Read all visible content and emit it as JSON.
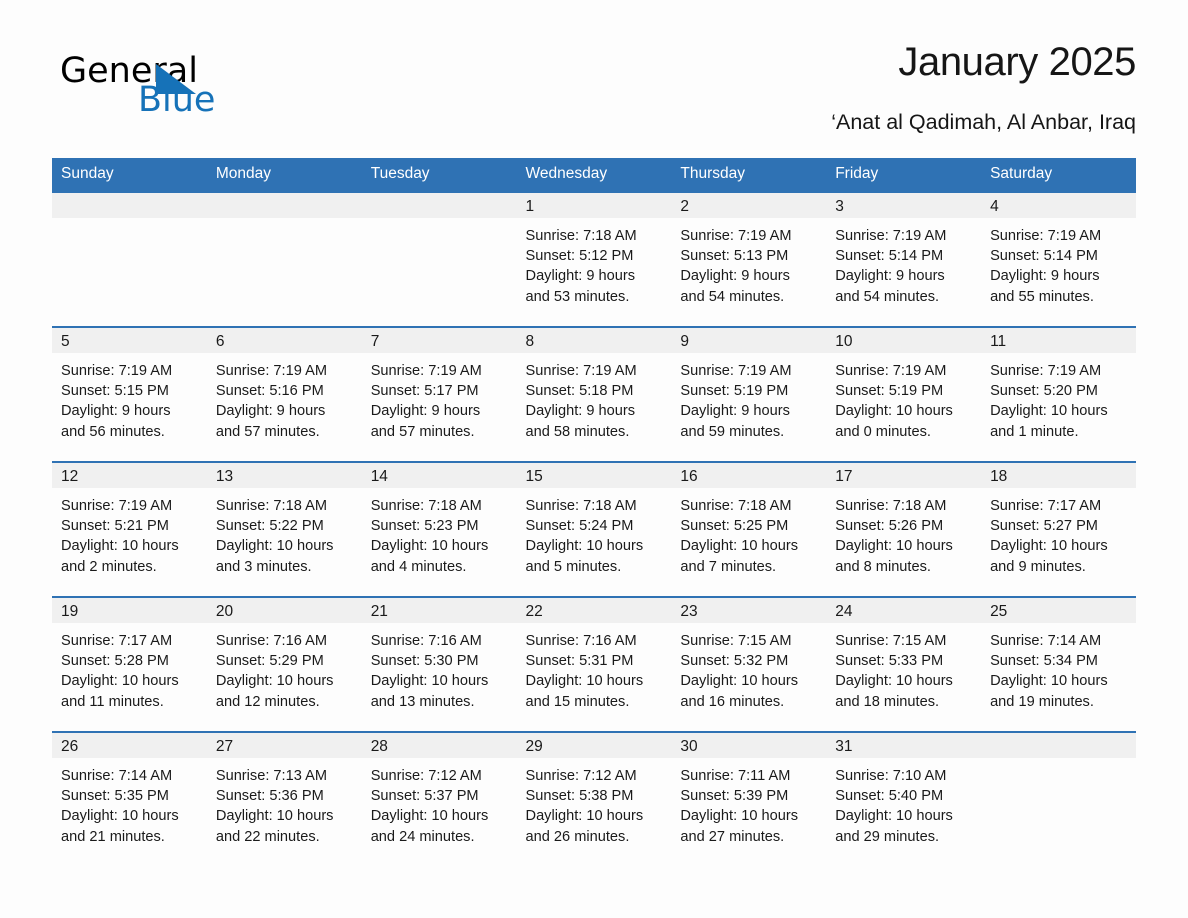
{
  "brand": {
    "logo_text_1": "General",
    "logo_text_2": "Blue",
    "logo_icon": "triangle-logo-icon",
    "accent_color": "#1672b8",
    "header_color": "#2f72b4"
  },
  "header": {
    "title": "January 2025",
    "subtitle": "‘Anat al Qadimah, Al Anbar, Iraq"
  },
  "calendar": {
    "weekday_headers": [
      "Sunday",
      "Monday",
      "Tuesday",
      "Wednesday",
      "Thursday",
      "Friday",
      "Saturday"
    ],
    "weeks": [
      [
        {
          "day": "",
          "empty": true
        },
        {
          "day": "",
          "empty": true
        },
        {
          "day": "",
          "empty": true
        },
        {
          "day": "1",
          "sunrise": "Sunrise: 7:18 AM",
          "sunset": "Sunset: 5:12 PM",
          "daylight_line1": "Daylight: 9 hours",
          "daylight_line2": "and 53 minutes."
        },
        {
          "day": "2",
          "sunrise": "Sunrise: 7:19 AM",
          "sunset": "Sunset: 5:13 PM",
          "daylight_line1": "Daylight: 9 hours",
          "daylight_line2": "and 54 minutes."
        },
        {
          "day": "3",
          "sunrise": "Sunrise: 7:19 AM",
          "sunset": "Sunset: 5:14 PM",
          "daylight_line1": "Daylight: 9 hours",
          "daylight_line2": "and 54 minutes."
        },
        {
          "day": "4",
          "sunrise": "Sunrise: 7:19 AM",
          "sunset": "Sunset: 5:14 PM",
          "daylight_line1": "Daylight: 9 hours",
          "daylight_line2": "and 55 minutes."
        }
      ],
      [
        {
          "day": "5",
          "sunrise": "Sunrise: 7:19 AM",
          "sunset": "Sunset: 5:15 PM",
          "daylight_line1": "Daylight: 9 hours",
          "daylight_line2": "and 56 minutes."
        },
        {
          "day": "6",
          "sunrise": "Sunrise: 7:19 AM",
          "sunset": "Sunset: 5:16 PM",
          "daylight_line1": "Daylight: 9 hours",
          "daylight_line2": "and 57 minutes."
        },
        {
          "day": "7",
          "sunrise": "Sunrise: 7:19 AM",
          "sunset": "Sunset: 5:17 PM",
          "daylight_line1": "Daylight: 9 hours",
          "daylight_line2": "and 57 minutes."
        },
        {
          "day": "8",
          "sunrise": "Sunrise: 7:19 AM",
          "sunset": "Sunset: 5:18 PM",
          "daylight_line1": "Daylight: 9 hours",
          "daylight_line2": "and 58 minutes."
        },
        {
          "day": "9",
          "sunrise": "Sunrise: 7:19 AM",
          "sunset": "Sunset: 5:19 PM",
          "daylight_line1": "Daylight: 9 hours",
          "daylight_line2": "and 59 minutes."
        },
        {
          "day": "10",
          "sunrise": "Sunrise: 7:19 AM",
          "sunset": "Sunset: 5:19 PM",
          "daylight_line1": "Daylight: 10 hours",
          "daylight_line2": "and 0 minutes."
        },
        {
          "day": "11",
          "sunrise": "Sunrise: 7:19 AM",
          "sunset": "Sunset: 5:20 PM",
          "daylight_line1": "Daylight: 10 hours",
          "daylight_line2": "and 1 minute."
        }
      ],
      [
        {
          "day": "12",
          "sunrise": "Sunrise: 7:19 AM",
          "sunset": "Sunset: 5:21 PM",
          "daylight_line1": "Daylight: 10 hours",
          "daylight_line2": "and 2 minutes."
        },
        {
          "day": "13",
          "sunrise": "Sunrise: 7:18 AM",
          "sunset": "Sunset: 5:22 PM",
          "daylight_line1": "Daylight: 10 hours",
          "daylight_line2": "and 3 minutes."
        },
        {
          "day": "14",
          "sunrise": "Sunrise: 7:18 AM",
          "sunset": "Sunset: 5:23 PM",
          "daylight_line1": "Daylight: 10 hours",
          "daylight_line2": "and 4 minutes."
        },
        {
          "day": "15",
          "sunrise": "Sunrise: 7:18 AM",
          "sunset": "Sunset: 5:24 PM",
          "daylight_line1": "Daylight: 10 hours",
          "daylight_line2": "and 5 minutes."
        },
        {
          "day": "16",
          "sunrise": "Sunrise: 7:18 AM",
          "sunset": "Sunset: 5:25 PM",
          "daylight_line1": "Daylight: 10 hours",
          "daylight_line2": "and 7 minutes."
        },
        {
          "day": "17",
          "sunrise": "Sunrise: 7:18 AM",
          "sunset": "Sunset: 5:26 PM",
          "daylight_line1": "Daylight: 10 hours",
          "daylight_line2": "and 8 minutes."
        },
        {
          "day": "18",
          "sunrise": "Sunrise: 7:17 AM",
          "sunset": "Sunset: 5:27 PM",
          "daylight_line1": "Daylight: 10 hours",
          "daylight_line2": "and 9 minutes."
        }
      ],
      [
        {
          "day": "19",
          "sunrise": "Sunrise: 7:17 AM",
          "sunset": "Sunset: 5:28 PM",
          "daylight_line1": "Daylight: 10 hours",
          "daylight_line2": "and 11 minutes."
        },
        {
          "day": "20",
          "sunrise": "Sunrise: 7:16 AM",
          "sunset": "Sunset: 5:29 PM",
          "daylight_line1": "Daylight: 10 hours",
          "daylight_line2": "and 12 minutes."
        },
        {
          "day": "21",
          "sunrise": "Sunrise: 7:16 AM",
          "sunset": "Sunset: 5:30 PM",
          "daylight_line1": "Daylight: 10 hours",
          "daylight_line2": "and 13 minutes."
        },
        {
          "day": "22",
          "sunrise": "Sunrise: 7:16 AM",
          "sunset": "Sunset: 5:31 PM",
          "daylight_line1": "Daylight: 10 hours",
          "daylight_line2": "and 15 minutes."
        },
        {
          "day": "23",
          "sunrise": "Sunrise: 7:15 AM",
          "sunset": "Sunset: 5:32 PM",
          "daylight_line1": "Daylight: 10 hours",
          "daylight_line2": "and 16 minutes."
        },
        {
          "day": "24",
          "sunrise": "Sunrise: 7:15 AM",
          "sunset": "Sunset: 5:33 PM",
          "daylight_line1": "Daylight: 10 hours",
          "daylight_line2": "and 18 minutes."
        },
        {
          "day": "25",
          "sunrise": "Sunrise: 7:14 AM",
          "sunset": "Sunset: 5:34 PM",
          "daylight_line1": "Daylight: 10 hours",
          "daylight_line2": "and 19 minutes."
        }
      ],
      [
        {
          "day": "26",
          "sunrise": "Sunrise: 7:14 AM",
          "sunset": "Sunset: 5:35 PM",
          "daylight_line1": "Daylight: 10 hours",
          "daylight_line2": "and 21 minutes."
        },
        {
          "day": "27",
          "sunrise": "Sunrise: 7:13 AM",
          "sunset": "Sunset: 5:36 PM",
          "daylight_line1": "Daylight: 10 hours",
          "daylight_line2": "and 22 minutes."
        },
        {
          "day": "28",
          "sunrise": "Sunrise: 7:12 AM",
          "sunset": "Sunset: 5:37 PM",
          "daylight_line1": "Daylight: 10 hours",
          "daylight_line2": "and 24 minutes."
        },
        {
          "day": "29",
          "sunrise": "Sunrise: 7:12 AM",
          "sunset": "Sunset: 5:38 PM",
          "daylight_line1": "Daylight: 10 hours",
          "daylight_line2": "and 26 minutes."
        },
        {
          "day": "30",
          "sunrise": "Sunrise: 7:11 AM",
          "sunset": "Sunset: 5:39 PM",
          "daylight_line1": "Daylight: 10 hours",
          "daylight_line2": "and 27 minutes."
        },
        {
          "day": "31",
          "sunrise": "Sunrise: 7:10 AM",
          "sunset": "Sunset: 5:40 PM",
          "daylight_line1": "Daylight: 10 hours",
          "daylight_line2": "and 29 minutes."
        },
        {
          "day": "",
          "empty": true
        }
      ]
    ]
  }
}
